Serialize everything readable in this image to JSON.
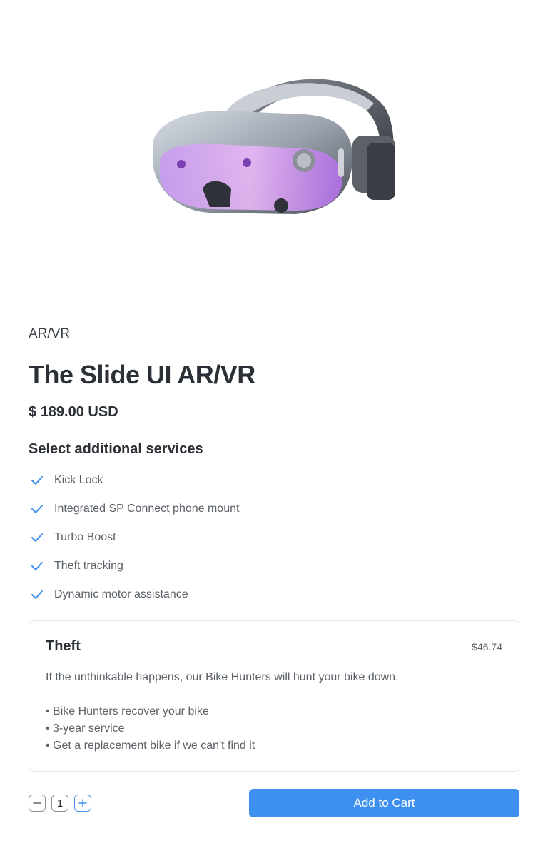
{
  "product": {
    "image_alt": "VR headset",
    "category": "AR/VR",
    "title": "The Slide UI AR/VR",
    "price": "$ 189.00 USD"
  },
  "services": {
    "heading": "Select additional services",
    "items": [
      {
        "label": "Kick Lock",
        "icon": "check-icon"
      },
      {
        "label": "Integrated SP Connect phone mount",
        "icon": "check-icon"
      },
      {
        "label": "Turbo Boost",
        "icon": "check-icon"
      },
      {
        "label": "Theft tracking",
        "icon": "check-icon"
      },
      {
        "label": "Dynamic motor assistance",
        "icon": "check-icon"
      }
    ]
  },
  "card": {
    "title": "Theft",
    "price": "$46.74",
    "description": "If the unthinkable happens, our Bike Hunters will hunt your bike down.",
    "bullets": [
      "• Bike Hunters recover your bike",
      "• 3-year service",
      "• Get a replacement bike if we can't find it"
    ]
  },
  "cart": {
    "quantity": "1",
    "add_label": "Add to Cart",
    "decrement_icon": "minus-icon",
    "increment_icon": "plus-icon"
  },
  "colors": {
    "accent": "#3d8ff0",
    "check": "#3d8ff0",
    "text_primary": "#2b3036",
    "text_secondary": "#5b6167",
    "border": "#e4e6ea"
  }
}
